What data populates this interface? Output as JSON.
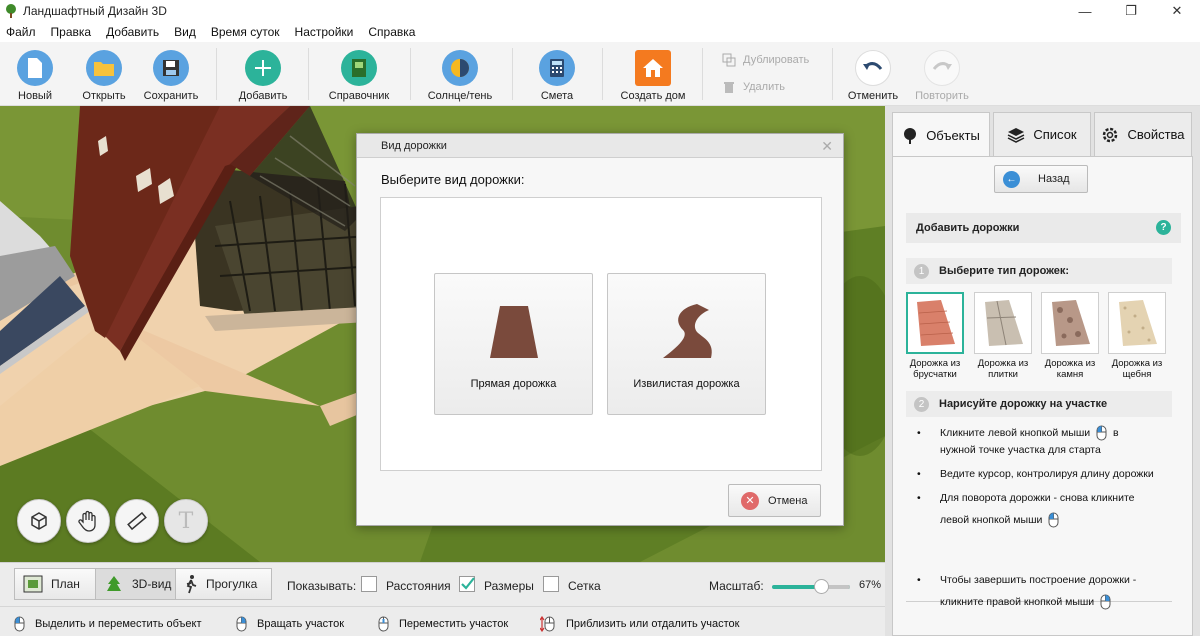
{
  "window": {
    "title": "Ландшафтный Дизайн 3D",
    "controls": [
      "—",
      "❐",
      "✕"
    ]
  },
  "menu": [
    "Файл",
    "Правка",
    "Добавить",
    "Вид",
    "Время суток",
    "Настройки",
    "Справка"
  ],
  "toolbar": {
    "new": "Новый",
    "open": "Открыть",
    "save": "Сохранить",
    "add": "Добавить",
    "reference": "Справочник",
    "sun_shadow": "Солнце/тень",
    "estimate": "Смета",
    "create_house": "Создать дом",
    "duplicate": "Дублировать",
    "delete": "Удалить",
    "undo": "Отменить",
    "redo": "Повторить"
  },
  "dialog": {
    "title": "Вид дорожки",
    "close": "✕",
    "prompt": "Выберите вид дорожки:",
    "straight": "Прямая дорожка",
    "curved": "Извилистая дорожка",
    "cancel": "Отмена",
    "cancel_icon": "✕"
  },
  "panel": {
    "tabs": {
      "objects": "Объекты",
      "list": "Список",
      "properties": "Свойства"
    },
    "back": "Назад",
    "back_icon": "←",
    "section_title": "Добавить дорожки",
    "help": "?",
    "step1_num": "1",
    "step1": "Выберите тип дорожек:",
    "step2_num": "2",
    "step2": "Нарисуйте дорожку на участке",
    "path_types": [
      {
        "label": "Дорожка из брусчатки",
        "color": "#d9806a"
      },
      {
        "label": "Дорожка из плитки",
        "color": "#c9bfb1"
      },
      {
        "label": "Дорожка из камня",
        "color": "#b89888"
      },
      {
        "label": "Дорожка из щебня",
        "color": "#e4d3b2"
      }
    ],
    "instr1": "Кликните левой кнопкой мыши",
    "instr1_b": "в",
    "instr1_c": "нужной точке участка для старта",
    "instr2": "Ведите курсор, контролируя длину дорожки",
    "instr3": "Для поворота дорожки - снова кликните",
    "instr3_b": "левой кнопкой мыши",
    "instr4": "Чтобы завершить построение дорожки -",
    "instr4_b": "кликните правой кнопкой мыши"
  },
  "viewbar": {
    "plan": "План",
    "view3d": "3D-вид",
    "walk": "Прогулка",
    "show": "Показывать:",
    "distances": "Расстояния",
    "distances_checked": false,
    "sizes": "Размеры",
    "sizes_checked": true,
    "grid": "Сетка",
    "grid_checked": false,
    "scale_label": "Масштаб:",
    "scale": "67%",
    "scale_value": 0.67
  },
  "viewport_tools": {
    "text": "T"
  },
  "status": {
    "select": "Выделить и переместить объект",
    "rotate": "Вращать участок",
    "move": "Переместить участок",
    "zoom": "Приблизить или отдалить участок"
  },
  "colors": {
    "accent": "#2cb39a",
    "roof": "#7a2f22",
    "grass": "#6e8b2d",
    "paving": "#f0cfa8"
  }
}
